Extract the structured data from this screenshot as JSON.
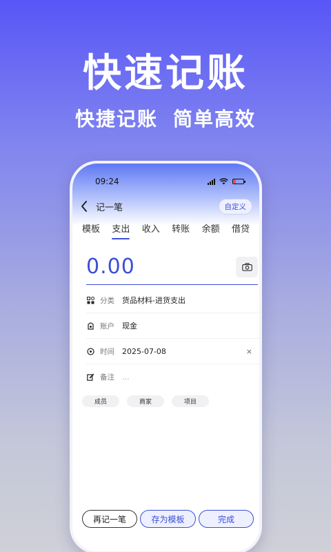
{
  "promo": {
    "headline": "快速记账",
    "sub_left": "快捷记账",
    "sub_right": "简单高效"
  },
  "status_bar": {
    "time": "09:24"
  },
  "nav": {
    "title": "记一笔",
    "custom_label": "自定义"
  },
  "tabs": [
    {
      "label": "模板"
    },
    {
      "label": "支出"
    },
    {
      "label": "收入"
    },
    {
      "label": "转账"
    },
    {
      "label": "余额"
    },
    {
      "label": "借贷"
    }
  ],
  "active_tab": "支出",
  "amount": "0.00",
  "fields": {
    "category": {
      "label": "分类",
      "value": "货品材料-进货支出"
    },
    "account": {
      "label": "账户",
      "value": "现金"
    },
    "time": {
      "label": "时间",
      "value": "2025-07-08",
      "clear": "×"
    },
    "note": {
      "label": "备注",
      "placeholder": "..."
    }
  },
  "chips": [
    {
      "label": "成员"
    },
    {
      "label": "商家"
    },
    {
      "label": "项目"
    }
  ],
  "buttons": {
    "again": "再记一笔",
    "save_template": "存为模板",
    "done": "完成"
  },
  "colors": {
    "accent": "#3c4fd6",
    "bg_top": "#5856f7",
    "bg_bottom": "#cfd0d8"
  }
}
